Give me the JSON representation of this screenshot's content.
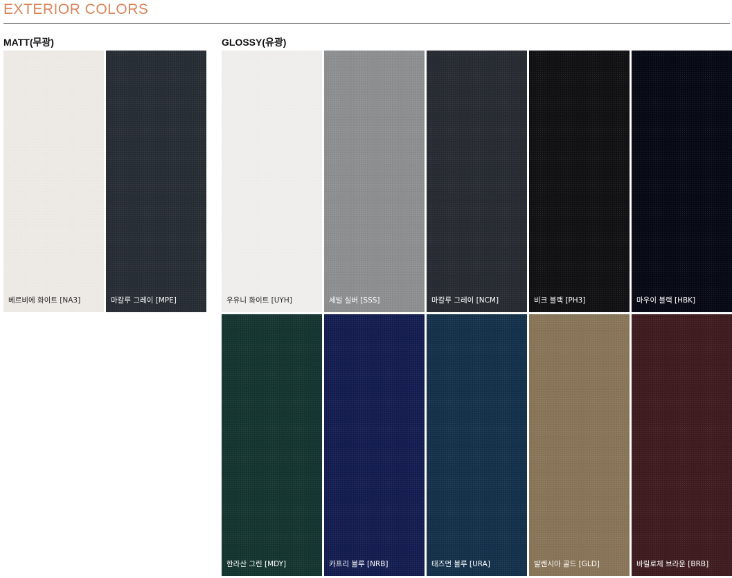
{
  "title": "EXTERIOR COLORS",
  "groups": [
    {
      "label": "MATT(무광)",
      "swatches": [
        {
          "name": "베르비에 화이트 [NA3]",
          "color": "#edeae6",
          "light": true
        },
        {
          "name": "마칼루 그레이 [MPE]",
          "color": "#262c33",
          "light": false
        }
      ]
    },
    {
      "label": "GLOSSY(유광)",
      "swatches": [
        {
          "name": "우유니 화이트 [UYH]",
          "color": "#efeeec",
          "light": true
        },
        {
          "name": "세빌 실버 [SSS]",
          "color": "#8c8e90",
          "light": false
        },
        {
          "name": "마칼루 그레이 [NCM]",
          "color": "#262b31",
          "light": false
        },
        {
          "name": "비크 블랙 [PH3]",
          "color": "#101013",
          "light": false
        },
        {
          "name": "마우이 블랙 [HBK]",
          "color": "#060913",
          "light": false
        },
        {
          "name": "한라산 그린 [MDY]",
          "color": "#14342f",
          "light": false
        },
        {
          "name": "카프리 블루 [NRB]",
          "color": "#131c4f",
          "light": false
        },
        {
          "name": "태즈먼 블루 [URA]",
          "color": "#13304a",
          "light": false
        },
        {
          "name": "발렌시아 골드 [GLD]",
          "color": "#887457",
          "light": false
        },
        {
          "name": "바릴로체 브라운 [BRB]",
          "color": "#3d1b1f",
          "light": false
        }
      ]
    }
  ]
}
